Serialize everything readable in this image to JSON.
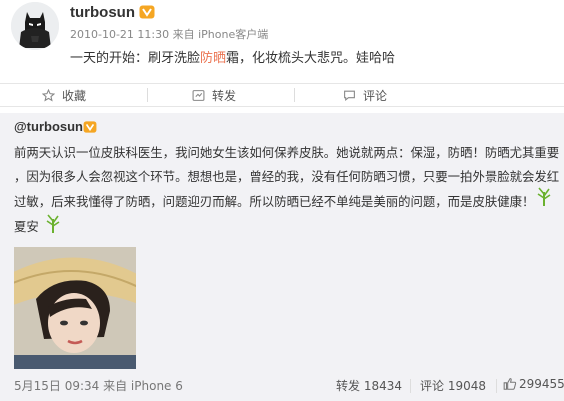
{
  "post": {
    "username": "turbosun",
    "meta": "2010-10-21 11:30 来自 iPhone客户端",
    "text_before": "一天的开始：刷牙洗脸",
    "text_highlight": "防晒",
    "text_after": "霜，化妆梳头大悲咒。娃哈哈"
  },
  "actions": {
    "favorite_label": "收藏",
    "repost_label": "转发",
    "comment_label": "评论"
  },
  "repost": {
    "username": "@turbosun",
    "lines": [
      "前两天认识一位皮肤科医生，我问她女生该如何保养皮肤。她说就两点：保湿，防晒！防晒尤其重要",
      "，因为很多人会忽视这个环节。想想也是，曾经的我，没有任何防晒习惯，只要一拍外景脸就会发红",
      "过敏，后来我懂得了防晒，问题迎刃而解。所以防晒已经不单纯是美丽的问题，而是皮肤健康！",
      "夏安"
    ],
    "meta": "5月15日 09:34 来自 iPhone 6",
    "repost_count_label": "转发 18434",
    "comment_count_label": "评论 19048",
    "like_count": "299455"
  },
  "colors": {
    "highlight": "#eb7350",
    "vip_badge": "#f5a623",
    "sprout": "#6bb12f"
  },
  "icons": [
    "star-icon",
    "repost-icon",
    "comment-icon",
    "thumbs-up-icon",
    "vip-badge-icon",
    "sprout-emoji-icon"
  ]
}
